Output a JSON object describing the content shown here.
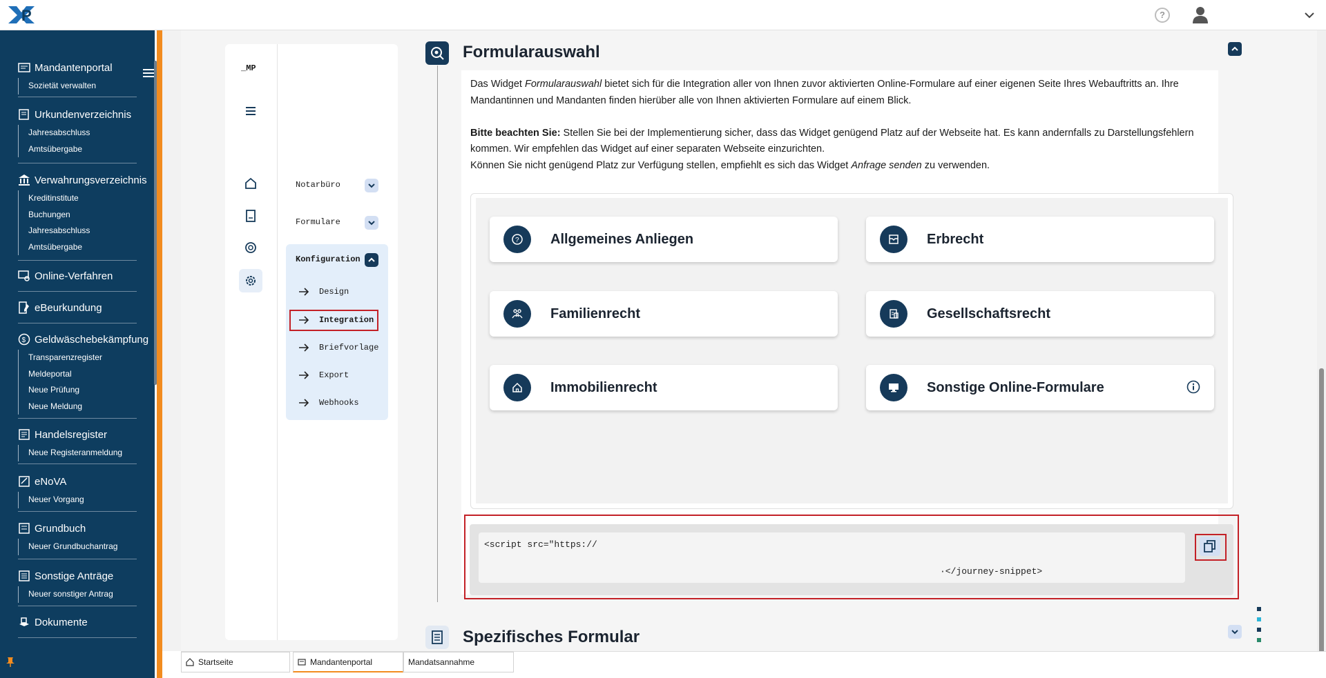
{
  "app": {
    "logo_text": "XP"
  },
  "topbar": {
    "help_label": "?"
  },
  "sidebar": {
    "groups": [
      {
        "label": "Mandantenportal",
        "icon": "portal-icon",
        "items": [
          "Sozietät verwalten"
        ]
      },
      {
        "label": "Urkundenverzeichnis",
        "icon": "book-icon",
        "items": [
          "Jahresabschluss",
          "Amtsübergabe"
        ]
      },
      {
        "label": "Verwahrungsverzeichnis",
        "icon": "bank-icon",
        "items": [
          "Kreditinstitute",
          "Buchungen",
          "Jahresabschluss",
          "Amtsübergabe"
        ]
      },
      {
        "label": "Online-Verfahren",
        "icon": "online-procedure-icon",
        "items": []
      },
      {
        "label": "eBeurkundung",
        "icon": "ebeurkundung-icon",
        "items": []
      },
      {
        "label": "Geldwäschebekämpfung",
        "icon": "money-laundering-icon",
        "items": [
          "Transparenzregister",
          "Meldeportal",
          "Neue Prüfung",
          "Neue Meldung"
        ]
      },
      {
        "label": "Handelsregister",
        "icon": "register-icon",
        "items": [
          "Neue Registeranmeldung"
        ]
      },
      {
        "label": "eNoVA",
        "icon": "enova-icon",
        "items": [
          "Neuer Vorgang"
        ]
      },
      {
        "label": "Grundbuch",
        "icon": "land-register-icon",
        "items": [
          "Neuer Grundbuchantrag"
        ]
      },
      {
        "label": "Sonstige Anträge",
        "icon": "other-requests-icon",
        "items": [
          "Neuer sonstiger Antrag"
        ]
      },
      {
        "label": "Dokumente",
        "icon": "documents-icon",
        "items": []
      }
    ]
  },
  "config_panel": {
    "brand": "_MP",
    "menu": [
      {
        "label": "Notarbüro",
        "expanded": false
      },
      {
        "label": "Formulare",
        "expanded": false
      },
      {
        "label": "Konfiguration",
        "expanded": true
      }
    ],
    "submenu": [
      "Design",
      "Integration",
      "Briefvorlage",
      "Export",
      "Webhooks"
    ],
    "active_submenu": "Integration"
  },
  "section1": {
    "title": "Formularauswahl",
    "p1_a": "Das Widget ",
    "p1_em": "Formularauswahl",
    "p1_b": " bietet sich für die Integration aller von Ihnen zuvor aktivierten Online-Formulare auf einer eigenen Seite Ihres Webauftritts an. Ihre Mandantinnen und Mandanten finden hierüber alle von Ihnen aktivierten Formulare auf einem Blick.",
    "p2_strong": "Bitte beachten Sie:",
    "p2_a": " Stellen Sie bei der Implementierung sicher, dass das Widget genügend Platz auf der Webseite hat. Es kann andernfalls zu Darstellungsfehlern kommen. Wir empfehlen das Widget auf einer separaten Webseite einzurichten.",
    "p3_a": "Können Sie nicht genügend Platz zur Verfügung stellen, empfiehlt es sich das Widget ",
    "p3_em": "Anfrage senden",
    "p3_b": " zu verwenden.",
    "cards": [
      {
        "label": "Allgemeines Anliegen",
        "icon": "question-circle-icon"
      },
      {
        "label": "Erbrecht",
        "icon": "inbox-icon"
      },
      {
        "label": "Familienrecht",
        "icon": "family-icon"
      },
      {
        "label": "Gesellschaftsrecht",
        "icon": "company-icon"
      },
      {
        "label": "Immobilienrecht",
        "icon": "house-icon"
      },
      {
        "label": "Sonstige Online-Formulare",
        "icon": "monitor-icon"
      }
    ],
    "code_line1": "<script src=\"https://",
    "code_line2": "·</journey-snippet>"
  },
  "section2": {
    "title": "Spezifisches Formular"
  },
  "tabs": [
    {
      "label": "Startseite",
      "icon": "home-icon"
    },
    {
      "label": "Mandantenportal",
      "icon": "portal-icon"
    },
    {
      "label": "Mandatsannahme",
      "icon": ""
    }
  ],
  "colors": {
    "navy": "#0e3d5f",
    "accent": "#f28c1f",
    "highlight": "#c32026"
  }
}
